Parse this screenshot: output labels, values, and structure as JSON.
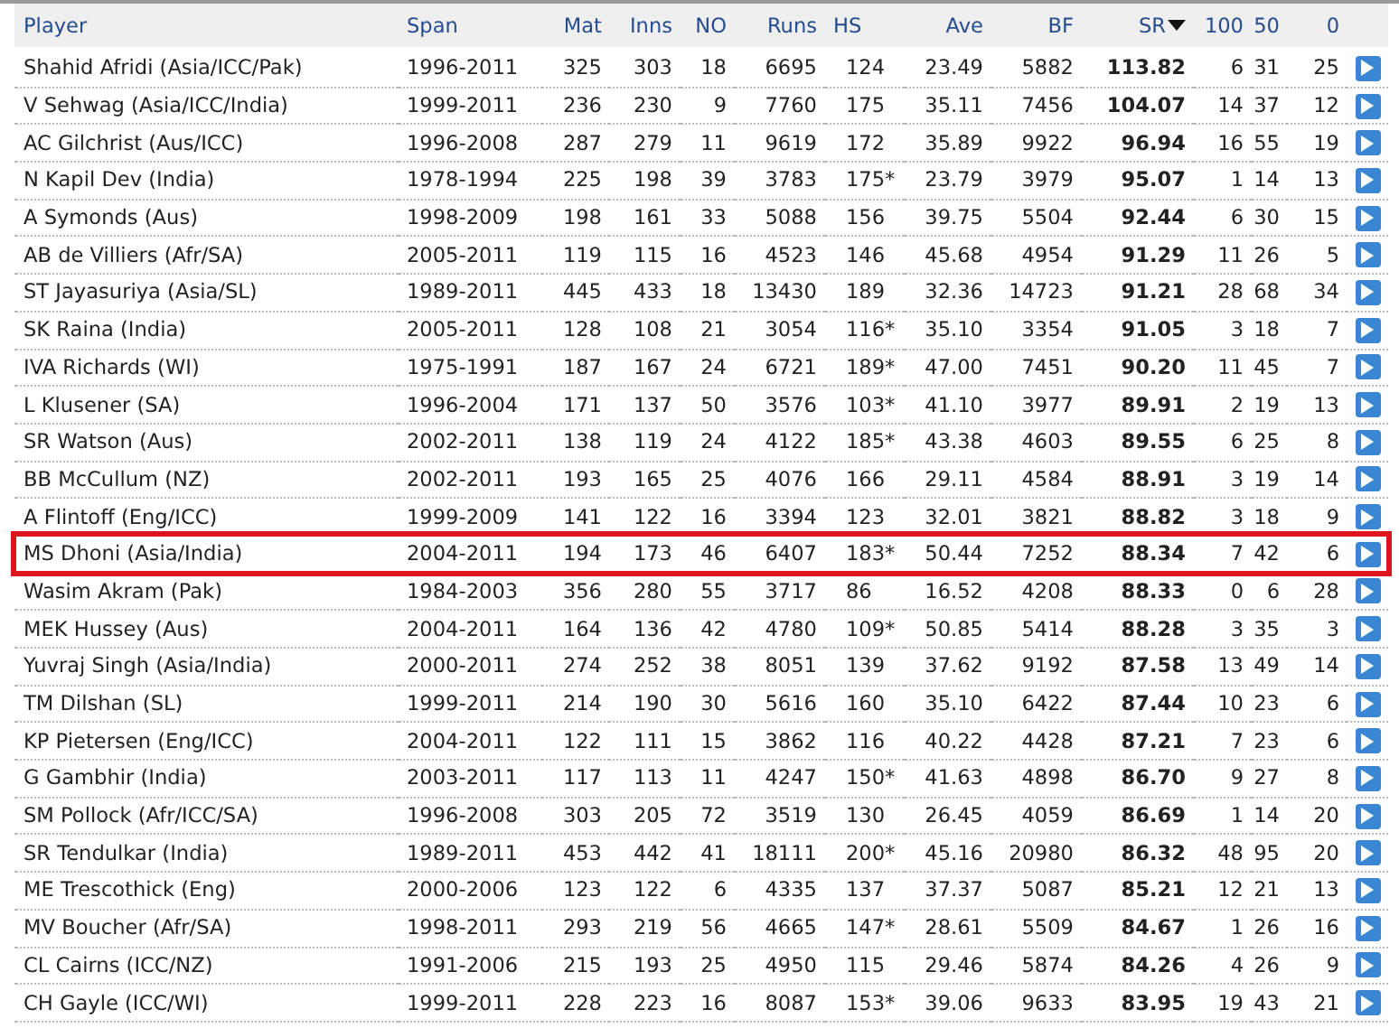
{
  "table": {
    "columns": [
      {
        "label": "Player",
        "sorted": false
      },
      {
        "label": "Span",
        "sorted": false
      },
      {
        "label": "Mat",
        "sorted": false
      },
      {
        "label": "Inns",
        "sorted": false
      },
      {
        "label": "NO",
        "sorted": false
      },
      {
        "label": "Runs",
        "sorted": false
      },
      {
        "label": "HS",
        "sorted": false
      },
      {
        "label": "Ave",
        "sorted": false
      },
      {
        "label": "BF",
        "sorted": false
      },
      {
        "label": "SR",
        "sorted": true
      },
      {
        "label": "100",
        "sorted": false
      },
      {
        "label": "50",
        "sorted": false
      },
      {
        "label": "0",
        "sorted": false
      }
    ],
    "rows": [
      {
        "highlighted": false,
        "cells": [
          "Shahid Afridi (Asia/ICC/Pak)",
          "1996-2011",
          "325",
          "303",
          "18",
          "6695",
          "124",
          "23.49",
          "5882",
          "113.82",
          "6",
          "31",
          "25"
        ]
      },
      {
        "highlighted": false,
        "cells": [
          "V Sehwag (Asia/ICC/India)",
          "1999-2011",
          "236",
          "230",
          "9",
          "7760",
          "175",
          "35.11",
          "7456",
          "104.07",
          "14",
          "37",
          "12"
        ]
      },
      {
        "highlighted": false,
        "cells": [
          "AC Gilchrist (Aus/ICC)",
          "1996-2008",
          "287",
          "279",
          "11",
          "9619",
          "172",
          "35.89",
          "9922",
          "96.94",
          "16",
          "55",
          "19"
        ]
      },
      {
        "highlighted": false,
        "cells": [
          "N Kapil Dev (India)",
          "1978-1994",
          "225",
          "198",
          "39",
          "3783",
          "175*",
          "23.79",
          "3979",
          "95.07",
          "1",
          "14",
          "13"
        ]
      },
      {
        "highlighted": false,
        "cells": [
          "A Symonds (Aus)",
          "1998-2009",
          "198",
          "161",
          "33",
          "5088",
          "156",
          "39.75",
          "5504",
          "92.44",
          "6",
          "30",
          "15"
        ]
      },
      {
        "highlighted": false,
        "cells": [
          "AB de Villiers (Afr/SA)",
          "2005-2011",
          "119",
          "115",
          "16",
          "4523",
          "146",
          "45.68",
          "4954",
          "91.29",
          "11",
          "26",
          "5"
        ]
      },
      {
        "highlighted": false,
        "cells": [
          "ST Jayasuriya (Asia/SL)",
          "1989-2011",
          "445",
          "433",
          "18",
          "13430",
          "189",
          "32.36",
          "14723",
          "91.21",
          "28",
          "68",
          "34"
        ]
      },
      {
        "highlighted": false,
        "cells": [
          "SK Raina (India)",
          "2005-2011",
          "128",
          "108",
          "21",
          "3054",
          "116*",
          "35.10",
          "3354",
          "91.05",
          "3",
          "18",
          "7"
        ]
      },
      {
        "highlighted": false,
        "cells": [
          "IVA Richards (WI)",
          "1975-1991",
          "187",
          "167",
          "24",
          "6721",
          "189*",
          "47.00",
          "7451",
          "90.20",
          "11",
          "45",
          "7"
        ]
      },
      {
        "highlighted": false,
        "cells": [
          "L Klusener (SA)",
          "1996-2004",
          "171",
          "137",
          "50",
          "3576",
          "103*",
          "41.10",
          "3977",
          "89.91",
          "2",
          "19",
          "13"
        ]
      },
      {
        "highlighted": false,
        "cells": [
          "SR Watson (Aus)",
          "2002-2011",
          "138",
          "119",
          "24",
          "4122",
          "185*",
          "43.38",
          "4603",
          "89.55",
          "6",
          "25",
          "8"
        ]
      },
      {
        "highlighted": false,
        "cells": [
          "BB McCullum (NZ)",
          "2002-2011",
          "193",
          "165",
          "25",
          "4076",
          "166",
          "29.11",
          "4584",
          "88.91",
          "3",
          "19",
          "14"
        ]
      },
      {
        "highlighted": false,
        "cells": [
          "A Flintoff (Eng/ICC)",
          "1999-2009",
          "141",
          "122",
          "16",
          "3394",
          "123",
          "32.01",
          "3821",
          "88.82",
          "3",
          "18",
          "9"
        ]
      },
      {
        "highlighted": true,
        "cells": [
          "MS Dhoni (Asia/India)",
          "2004-2011",
          "194",
          "173",
          "46",
          "6407",
          "183*",
          "50.44",
          "7252",
          "88.34",
          "7",
          "42",
          "6"
        ]
      },
      {
        "highlighted": false,
        "cells": [
          "Wasim Akram (Pak)",
          "1984-2003",
          "356",
          "280",
          "55",
          "3717",
          "86",
          "16.52",
          "4208",
          "88.33",
          "0",
          "6",
          "28"
        ]
      },
      {
        "highlighted": false,
        "cells": [
          "MEK Hussey (Aus)",
          "2004-2011",
          "164",
          "136",
          "42",
          "4780",
          "109*",
          "50.85",
          "5414",
          "88.28",
          "3",
          "35",
          "3"
        ]
      },
      {
        "highlighted": false,
        "cells": [
          "Yuvraj Singh (Asia/India)",
          "2000-2011",
          "274",
          "252",
          "38",
          "8051",
          "139",
          "37.62",
          "9192",
          "87.58",
          "13",
          "49",
          "14"
        ]
      },
      {
        "highlighted": false,
        "cells": [
          "TM Dilshan (SL)",
          "1999-2011",
          "214",
          "190",
          "30",
          "5616",
          "160",
          "35.10",
          "6422",
          "87.44",
          "10",
          "23",
          "6"
        ]
      },
      {
        "highlighted": false,
        "cells": [
          "KP Pietersen (Eng/ICC)",
          "2004-2011",
          "122",
          "111",
          "15",
          "3862",
          "116",
          "40.22",
          "4428",
          "87.21",
          "7",
          "23",
          "6"
        ]
      },
      {
        "highlighted": false,
        "cells": [
          "G Gambhir (India)",
          "2003-2011",
          "117",
          "113",
          "11",
          "4247",
          "150*",
          "41.63",
          "4898",
          "86.70",
          "9",
          "27",
          "8"
        ]
      },
      {
        "highlighted": false,
        "cells": [
          "SM Pollock (Afr/ICC/SA)",
          "1996-2008",
          "303",
          "205",
          "72",
          "3519",
          "130",
          "26.45",
          "4059",
          "86.69",
          "1",
          "14",
          "20"
        ]
      },
      {
        "highlighted": false,
        "cells": [
          "SR Tendulkar (India)",
          "1989-2011",
          "453",
          "442",
          "41",
          "18111",
          "200*",
          "45.16",
          "20980",
          "86.32",
          "48",
          "95",
          "20"
        ]
      },
      {
        "highlighted": false,
        "cells": [
          "ME Trescothick (Eng)",
          "2000-2006",
          "123",
          "122",
          "6",
          "4335",
          "137",
          "37.37",
          "5087",
          "85.21",
          "12",
          "21",
          "13"
        ]
      },
      {
        "highlighted": false,
        "cells": [
          "MV Boucher (Afr/SA)",
          "1998-2011",
          "293",
          "219",
          "56",
          "4665",
          "147*",
          "28.61",
          "5509",
          "84.67",
          "1",
          "26",
          "16"
        ]
      },
      {
        "highlighted": false,
        "cells": [
          "CL Cairns (ICC/NZ)",
          "1991-2006",
          "215",
          "193",
          "25",
          "4950",
          "115",
          "29.46",
          "5874",
          "84.26",
          "4",
          "26",
          "9"
        ]
      },
      {
        "highlighted": false,
        "cells": [
          "CH Gayle (ICC/WI)",
          "1999-2011",
          "228",
          "223",
          "16",
          "8087",
          "153*",
          "39.06",
          "9633",
          "83.95",
          "19",
          "43",
          "21"
        ]
      }
    ]
  }
}
